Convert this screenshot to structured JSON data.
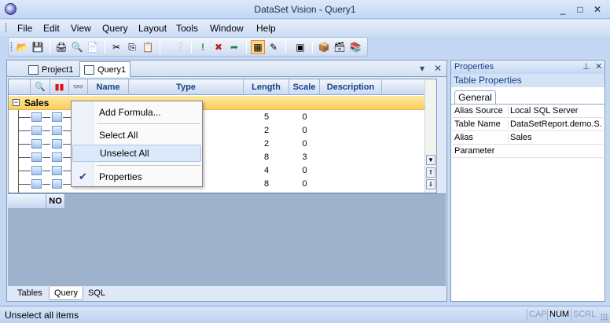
{
  "window": {
    "title": "DataSet Vision - Query1",
    "controls": [
      "_",
      "□",
      "✕"
    ]
  },
  "menu": [
    "File",
    "Edit",
    "View",
    "Query",
    "Layout",
    "Tools",
    "Window",
    "Help"
  ],
  "doc_tabs": [
    {
      "label": "Project1",
      "active": false
    },
    {
      "label": "Query1",
      "active": true
    }
  ],
  "grid": {
    "columns": [
      "",
      "",
      "",
      "Name",
      "Type",
      "Length",
      "Scale",
      "Description"
    ],
    "group": "Sales",
    "rows": [
      {
        "length": "5",
        "scale": "0"
      },
      {
        "length": "2",
        "scale": "0"
      },
      {
        "length": "2",
        "scale": "0"
      },
      {
        "length": "8",
        "scale": "3"
      },
      {
        "length": "4",
        "scale": "0"
      },
      {
        "length": "8",
        "scale": "0"
      }
    ]
  },
  "context_menu": {
    "items": [
      "Add Formula...",
      "Select All",
      "Unselect All",
      "Properties"
    ],
    "hovered": "Unselect All",
    "checked": "Properties"
  },
  "lower_grid": {
    "header": "NO"
  },
  "bottom_tabs": [
    "Tables",
    "Query",
    "SQL"
  ],
  "active_bottom_tab": "Query",
  "properties": {
    "title": "Properties",
    "subtitle": "Table Properties",
    "tab": "General",
    "rows": [
      {
        "name": "Alias Source",
        "value": "Local SQL Server"
      },
      {
        "name": "Table Name",
        "value": "DataSetReport.demo.S..."
      },
      {
        "name": "Alias",
        "value": "Sales"
      },
      {
        "name": "Parameter",
        "value": ""
      }
    ]
  },
  "status": {
    "message": "Unselect all items",
    "indicators": [
      {
        "label": "CAP",
        "on": false
      },
      {
        "label": "NUM",
        "on": true
      },
      {
        "label": "SCRL",
        "on": false
      }
    ]
  },
  "colors": {
    "group_row": "#f9cf5d",
    "accent": "#15428b",
    "menu_hover": "#dce9fb"
  }
}
